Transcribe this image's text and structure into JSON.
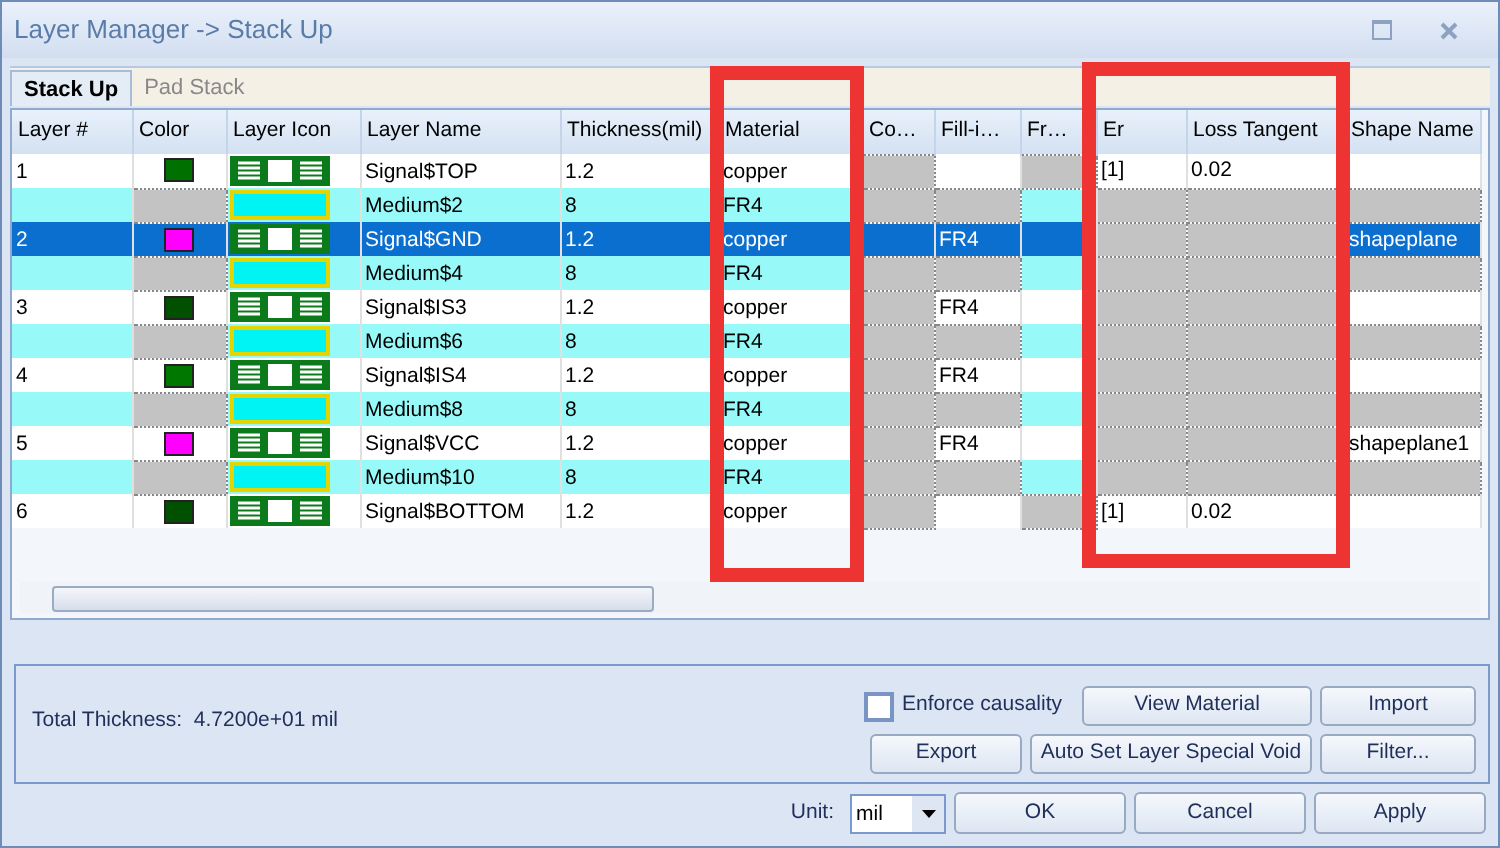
{
  "window": {
    "title": "Layer Manager -> Stack Up"
  },
  "tabs": [
    {
      "label": "Stack Up",
      "selected": true
    },
    {
      "label": "Pad Stack",
      "selected": false
    }
  ],
  "table": {
    "columns": [
      "Layer #",
      "Color",
      "Layer Icon",
      "Layer Name",
      "Thickness(mil)",
      "Material",
      "Co…",
      "Fill-i…",
      "Fr…",
      "Er",
      "Loss Tangent",
      "Shape Name"
    ],
    "rows": [
      {
        "kind": "signal",
        "selected": false,
        "layer": "1",
        "color": "#007000",
        "name": "Signal$TOP",
        "thickness": "1.2",
        "material": "copper",
        "extra": [
          {
            "disabled": true
          },
          {
            "disabled": false
          },
          {
            "disabled": true
          },
          {
            "disabled": false,
            "text": "[1]"
          },
          {
            "disabled": false,
            "text": "0.02"
          },
          {
            "disabled": false
          }
        ]
      },
      {
        "kind": "medium",
        "selected": false,
        "name": "Medium$2",
        "thickness": "8",
        "material": "FR4",
        "extra": [
          {
            "disabled": true
          },
          {
            "disabled": true
          },
          {
            "disabled": false
          },
          {
            "disabled": true
          },
          {
            "disabled": true
          },
          {
            "disabled": true
          }
        ]
      },
      {
        "kind": "signal",
        "selected": true,
        "layer": "2",
        "color": "#ff00ff",
        "name": "Signal$GND",
        "thickness": "1.2",
        "material": "copper",
        "extra": [
          {
            "disabled": false
          },
          {
            "disabled": false,
            "text": "FR4"
          },
          {
            "disabled": false
          },
          {
            "disabled": true
          },
          {
            "disabled": true
          },
          {
            "disabled": false,
            "text": "shapeplane"
          }
        ]
      },
      {
        "kind": "medium",
        "selected": false,
        "name": "Medium$4",
        "thickness": "8",
        "material": "FR4",
        "extra": [
          {
            "disabled": true
          },
          {
            "disabled": true
          },
          {
            "disabled": false
          },
          {
            "disabled": true
          },
          {
            "disabled": true
          },
          {
            "disabled": true
          }
        ]
      },
      {
        "kind": "signal",
        "selected": false,
        "layer": "3",
        "color": "#005000",
        "name": "Signal$IS3",
        "thickness": "1.2",
        "material": "copper",
        "extra": [
          {
            "disabled": true
          },
          {
            "disabled": false,
            "text": "FR4"
          },
          {
            "disabled": false
          },
          {
            "disabled": true
          },
          {
            "disabled": true
          },
          {
            "disabled": false
          }
        ]
      },
      {
        "kind": "medium",
        "selected": false,
        "name": "Medium$6",
        "thickness": "8",
        "material": "FR4",
        "extra": [
          {
            "disabled": true
          },
          {
            "disabled": true
          },
          {
            "disabled": false
          },
          {
            "disabled": true
          },
          {
            "disabled": true
          },
          {
            "disabled": true
          }
        ]
      },
      {
        "kind": "signal",
        "selected": false,
        "layer": "4",
        "color": "#007800",
        "name": "Signal$IS4",
        "thickness": "1.2",
        "material": "copper",
        "extra": [
          {
            "disabled": true
          },
          {
            "disabled": false,
            "text": "FR4"
          },
          {
            "disabled": false
          },
          {
            "disabled": true
          },
          {
            "disabled": true
          },
          {
            "disabled": false
          }
        ]
      },
      {
        "kind": "medium",
        "selected": false,
        "name": "Medium$8",
        "thickness": "8",
        "material": "FR4",
        "extra": [
          {
            "disabled": true
          },
          {
            "disabled": true
          },
          {
            "disabled": false
          },
          {
            "disabled": true
          },
          {
            "disabled": true
          },
          {
            "disabled": true
          }
        ]
      },
      {
        "kind": "signal",
        "selected": false,
        "layer": "5",
        "color": "#ff00ff",
        "name": "Signal$VCC",
        "thickness": "1.2",
        "material": "copper",
        "extra": [
          {
            "disabled": true
          },
          {
            "disabled": false,
            "text": "FR4"
          },
          {
            "disabled": false
          },
          {
            "disabled": true
          },
          {
            "disabled": true
          },
          {
            "disabled": false,
            "text": "shapeplane1"
          }
        ]
      },
      {
        "kind": "medium",
        "selected": false,
        "name": "Medium$10",
        "thickness": "8",
        "material": "FR4",
        "extra": [
          {
            "disabled": true
          },
          {
            "disabled": true
          },
          {
            "disabled": false
          },
          {
            "disabled": true
          },
          {
            "disabled": true
          },
          {
            "disabled": true
          }
        ]
      },
      {
        "kind": "signal",
        "selected": false,
        "layer": "6",
        "color": "#005000",
        "name": "Signal$BOTTOM",
        "thickness": "1.2",
        "material": "copper",
        "extra": [
          {
            "disabled": true
          },
          {
            "disabled": false
          },
          {
            "disabled": true
          },
          {
            "disabled": false,
            "text": "[1]"
          },
          {
            "disabled": false,
            "text": "0.02"
          },
          {
            "disabled": false
          }
        ]
      }
    ]
  },
  "summary": {
    "label": "Total Thickness:",
    "value": "4.7200e+01 mil"
  },
  "enforce_causality": {
    "label": "Enforce causality",
    "checked": false
  },
  "action_buttons": [
    "View Material",
    "Import",
    "Export",
    "Auto Set Layer Special Void",
    "Filter..."
  ],
  "unit": {
    "label": "Unit:",
    "value": "mil"
  },
  "dialog_buttons": [
    "OK",
    "Cancel",
    "Apply"
  ]
}
